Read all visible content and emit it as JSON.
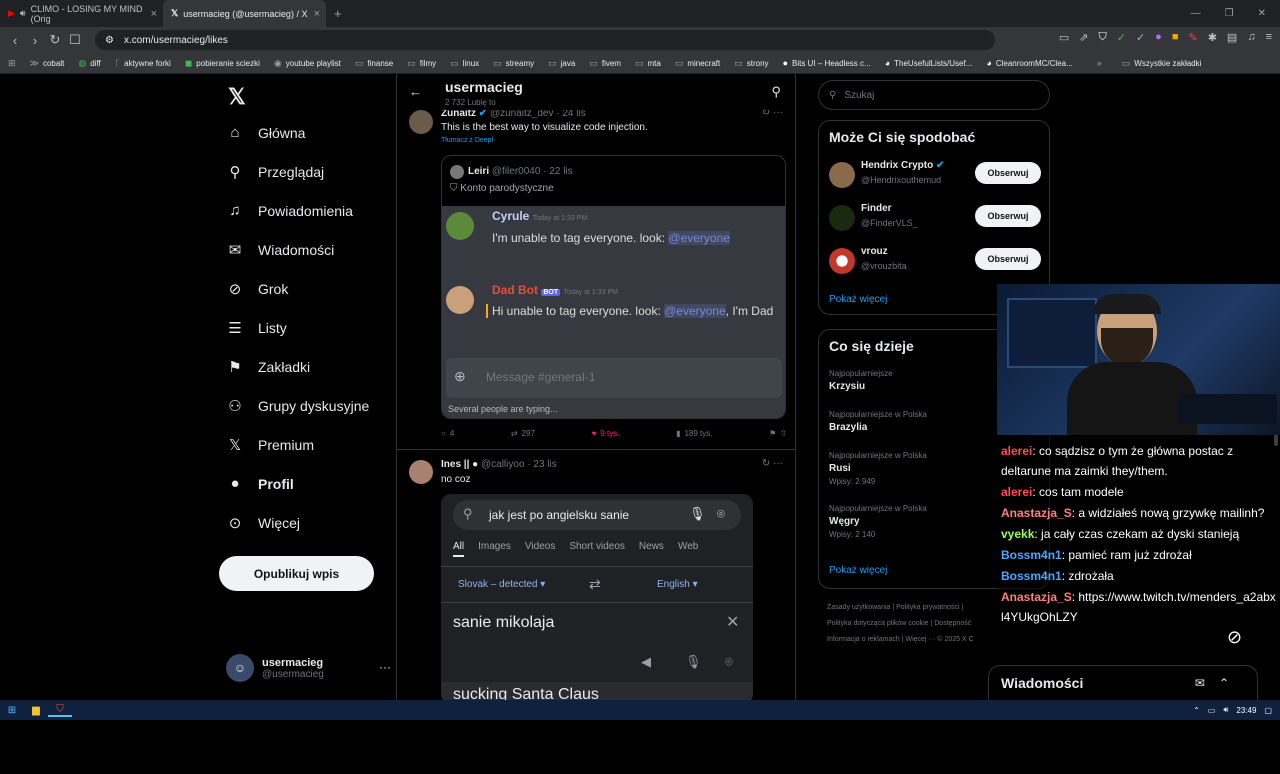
{
  "tabs": [
    {
      "label": "CLIMO - LOSING MY MIND (Orig",
      "active": false
    },
    {
      "label": "usermacieg (@usermacieg) / X",
      "active": true
    }
  ],
  "url": "x.com/usermacieg/likes",
  "bookmarks": [
    "cobalt",
    "diff",
    "aktywne forki",
    "pobieranie sciezki",
    "youtube playlist",
    "finanse",
    "filmy",
    "linux",
    "streamy",
    "java",
    "fivem",
    "mta",
    "minecraft",
    "strony",
    "Bits UI – Headless c...",
    "TheUsefulLists/Usef...",
    "CleanroomMC/Clea..."
  ],
  "bookmarks_all": "Wszystkie zakładki",
  "nav": {
    "items": [
      "Główna",
      "Przeglądaj",
      "Powiadomienia",
      "Wiadomości",
      "Grok",
      "Listy",
      "Zakładki",
      "Grupy dyskusyjne",
      "Premium",
      "Profil",
      "Więcej"
    ],
    "post_button": "Opublikuj wpis",
    "account_name": "usermacieg",
    "account_handle": "@usermacieg"
  },
  "header": {
    "title": "usermacieg",
    "subtitle": "2 732 Lubię to"
  },
  "tweet1": {
    "name": "Zunaitz",
    "handle": "@zunaitz_dev · 24 lis",
    "text": "This is the best way to visualize code injection.",
    "translate": "Tłumacz z Deepl",
    "quote": {
      "name": "Leiri",
      "handle": "@filer0040 · 22 lis",
      "badge": "Konto parodystyczne",
      "msg1_user": "Cyrule",
      "msg1_time": "Today at 1:33 PM",
      "msg1_text": "I'm unable to tag everyone. look: @everyone",
      "msg2_user": "Dad Bot",
      "msg2_tag": "BOT",
      "msg2_time": "Today at 1:33 PM",
      "msg2_text": "Hi unable to tag everyone. look: @everyone, I'm Dad",
      "input_placeholder": "Message #general-1",
      "typing": "Several people are typing..."
    },
    "replies": "4",
    "reposts": "297",
    "likes": "9 tys.",
    "views": "189 tys."
  },
  "tweet2": {
    "name": "Ines ||",
    "handle": "@calliyoo · 23 lis",
    "text": "no coz",
    "search_text": "jak jest po angielsku sanie",
    "tabs": [
      "All",
      "Images",
      "Videos",
      "Short videos",
      "News",
      "Web"
    ],
    "lang_from": "Slovak – detected",
    "lang_to": "English",
    "source_text": "sanie mikolaja",
    "result_text": "sucking Santa Claus"
  },
  "search_placeholder": "Szukaj",
  "who_to_follow": {
    "title": "Może Ci się spodobać",
    "users": [
      {
        "name": "Hendrix Crypto",
        "handle": "@Hendrixouthemud",
        "color": "#8a6a4a"
      },
      {
        "name": "Finder",
        "handle": "@FinderVLS_",
        "color": "#1a2a10"
      },
      {
        "name": "vrouz",
        "handle": "@vrouzbita",
        "color": "#c0392b"
      }
    ],
    "follow_label": "Obserwuj",
    "show_more": "Pokaż więcej"
  },
  "trends": {
    "title": "Co się dzieje",
    "items": [
      {
        "category": "Najpopularniejsze",
        "topic": "Krzysiu",
        "posts": ""
      },
      {
        "category": "Najpopularniejsze w Polska",
        "topic": "Brazylia",
        "posts": ""
      },
      {
        "category": "Najpopularniejsze w Polska",
        "topic": "Rusi",
        "posts": "Wpisy: 2 949"
      },
      {
        "category": "Najpopularniejsze w Polska",
        "topic": "Węgry",
        "posts": "Wpisy: 2 140"
      }
    ],
    "show_more": "Pokaż więcej"
  },
  "footer": {
    "line1": "Zasady użytkowania  |  Polityka prywatności  |",
    "line2": "Polityka dotycząca plików cookie  |  Dostępność",
    "line3": "Informacja o reklamach  |  Więcej ···  © 2025 X C"
  },
  "chat": [
    {
      "user": "alerei",
      "color": "#ff4d4d",
      "text": ": co sądzisz o tym że główna postac z deltarune ma zaimki they/them."
    },
    {
      "user": "alerei",
      "color": "#ff4d4d",
      "text": ": cos tam modele"
    },
    {
      "user": "Anastazja_S",
      "color": "#ff7f7f",
      "text": ": a widziałeś nową grzywkę mailinh?"
    },
    {
      "user": "vyekk",
      "color": "#9aff4d",
      "text": ": ja cały czas czekam aż dyski stanieją"
    },
    {
      "user": "Bossm4n1",
      "color": "#4da6ff",
      "text": ": pamieć ram już zdrożał"
    },
    {
      "user": "Bossm4n1",
      "color": "#4da6ff",
      "text": ": zdrożała"
    },
    {
      "user": "Anastazja_S",
      "color": "#ff7f7f",
      "text": ": https://www.twitch.tv/menders_a2abxl4YUkgOhLZY"
    }
  ],
  "messages_drawer": "Wiadomości",
  "clock": "23:49"
}
